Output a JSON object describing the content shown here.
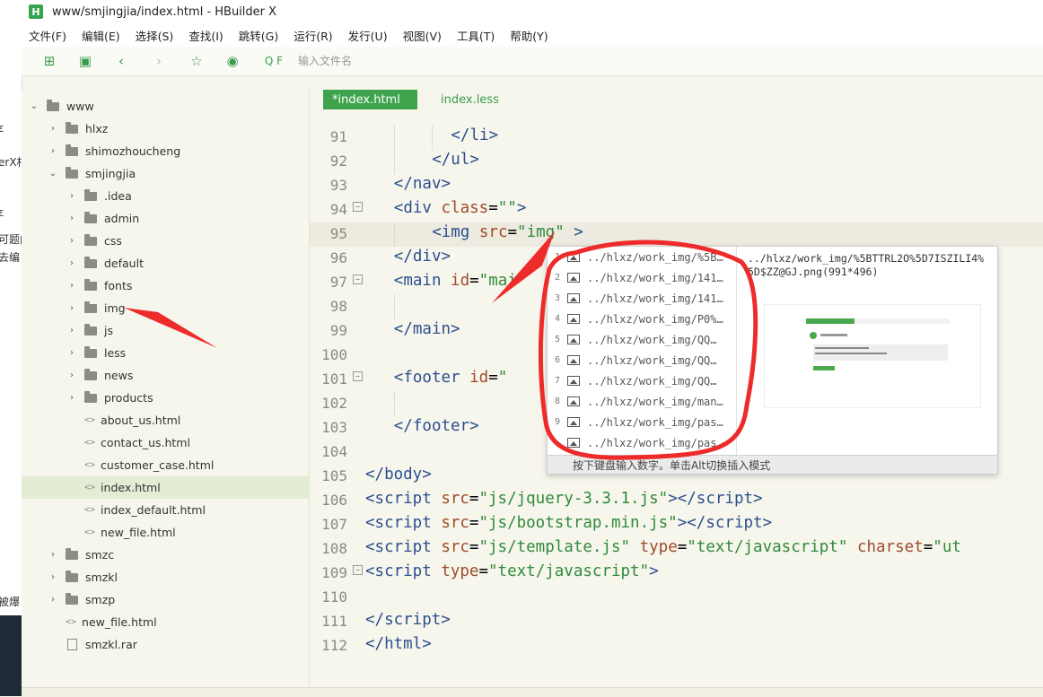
{
  "window": {
    "title": "www/smjingjia/index.html - HBuilder X",
    "logo": "H"
  },
  "background_fragments": [
    "ε",
    "erX相",
    "ε",
    "可题内",
    "去编",
    "被爆"
  ],
  "menu": [
    "文件(F)",
    "编辑(E)",
    "选择(S)",
    "查找(I)",
    "跳转(G)",
    "运行(R)",
    "发行(U)",
    "视图(V)",
    "工具(T)",
    "帮助(Y)"
  ],
  "toolbar": {
    "search_placeholder": "输入文件名",
    "search_prefix": "Q F"
  },
  "file_tree": [
    {
      "label": "www",
      "type": "folder",
      "open": true
    },
    {
      "label": "hlxz",
      "type": "folder"
    },
    {
      "label": "shimozhoucheng",
      "type": "folder"
    },
    {
      "label": "smjingjia",
      "type": "folder",
      "open": true
    },
    {
      "label": ".idea",
      "type": "folder"
    },
    {
      "label": "admin",
      "type": "folder"
    },
    {
      "label": "css",
      "type": "folder"
    },
    {
      "label": "default",
      "type": "folder"
    },
    {
      "label": "fonts",
      "type": "folder"
    },
    {
      "label": "img",
      "type": "folder"
    },
    {
      "label": "js",
      "type": "folder"
    },
    {
      "label": "less",
      "type": "folder"
    },
    {
      "label": "news",
      "type": "folder"
    },
    {
      "label": "products",
      "type": "folder"
    },
    {
      "label": "about_us.html",
      "type": "file"
    },
    {
      "label": "contact_us.html",
      "type": "file"
    },
    {
      "label": "customer_case.html",
      "type": "file"
    },
    {
      "label": "index.html",
      "type": "file",
      "selected": true
    },
    {
      "label": "index_default.html",
      "type": "file"
    },
    {
      "label": "new_file.html",
      "type": "file"
    },
    {
      "label": "smzc",
      "type": "folder"
    },
    {
      "label": "smzkl",
      "type": "folder"
    },
    {
      "label": "smzp",
      "type": "folder"
    },
    {
      "label": "new_file.html",
      "type": "file"
    },
    {
      "label": "smzkl.rar",
      "type": "archive"
    }
  ],
  "tabs": [
    {
      "label": "*index.html",
      "active": true
    },
    {
      "label": "index.less",
      "active": false
    }
  ],
  "code_lines": [
    {
      "n": "91",
      "html": "<span class=\"tag\">&lt;/li&gt;</span>"
    },
    {
      "n": "92",
      "html": "<span class=\"tag\">&lt;/ul&gt;</span>"
    },
    {
      "n": "93",
      "html": "<span class=\"tag\">&lt;/nav&gt;</span>"
    },
    {
      "n": "94",
      "html": "<span class=\"tag\">&lt;div</span> <span class=\"attr\">class</span>=<span class=\"str\">\"\"</span><span class=\"tag\">&gt;</span>"
    },
    {
      "n": "95",
      "html": "<span class=\"tag\">&lt;img</span> <span class=\"attr\">src</span>=<span class=\"str\">\"img\"</span> <span class=\"tag\">&gt;</span>"
    },
    {
      "n": "96",
      "html": "<span class=\"tag\">&lt;/div&gt;</span>"
    },
    {
      "n": "97",
      "html": "<span class=\"tag\">&lt;main</span> <span class=\"attr\">id</span>=<span class=\"str\">\"mai</span>"
    },
    {
      "n": "98",
      "html": ""
    },
    {
      "n": "99",
      "html": "<span class=\"tag\">&lt;/main&gt;</span>"
    },
    {
      "n": "100",
      "html": ""
    },
    {
      "n": "101",
      "html": "<span class=\"tag\">&lt;footer</span> <span class=\"attr\">id</span>=<span class=\"str\">\"</span>"
    },
    {
      "n": "102",
      "html": ""
    },
    {
      "n": "103",
      "html": "<span class=\"tag\">&lt;/footer&gt;</span>"
    },
    {
      "n": "104",
      "html": ""
    },
    {
      "n": "105",
      "html": "<span class=\"tag\">&lt;/body&gt;</span>"
    },
    {
      "n": "106",
      "html": "<span class=\"tag\">&lt;script</span> <span class=\"attr\">src</span>=<span class=\"str\">\"js/jquery-3.3.1.js\"</span><span class=\"tag\">&gt;&lt;/script&gt;</span>"
    },
    {
      "n": "107",
      "html": "<span class=\"tag\">&lt;script</span> <span class=\"attr\">src</span>=<span class=\"str\">\"js/bootstrap.min.js\"</span><span class=\"tag\">&gt;&lt;/script&gt;</span>"
    },
    {
      "n": "108",
      "html": "<span class=\"tag\">&lt;script</span> <span class=\"attr\">src</span>=<span class=\"str\">\"js/template.js\"</span> <span class=\"attr\">type</span>=<span class=\"str\">\"text/javascript\"</span> <span class=\"attr\">charset</span>=<span class=\"str\">\"ut</span>"
    },
    {
      "n": "109",
      "html": "<span class=\"tag\">&lt;script</span> <span class=\"attr\">type</span>=<span class=\"str\">\"text/javascript\"</span><span class=\"tag\">&gt;</span>"
    },
    {
      "n": "110",
      "html": ""
    },
    {
      "n": "111",
      "html": "<span class=\"tag\">&lt;/script&gt;</span>"
    },
    {
      "n": "112",
      "html": "<span class=\"tag\">&lt;/html&gt;</span>"
    }
  ],
  "fold_lines": [
    "94",
    "97",
    "101",
    "109"
  ],
  "current_line": "95",
  "autocomplete": {
    "items": [
      {
        "num": "1",
        "path": "../hlxz/work_img/%5B…"
      },
      {
        "num": "2",
        "path": "../hlxz/work_img/141…"
      },
      {
        "num": "3",
        "path": "../hlxz/work_img/141…"
      },
      {
        "num": "4",
        "path": "../hlxz/work_img/P0%…"
      },
      {
        "num": "5",
        "path": "../hlxz/work_img/QQ…"
      },
      {
        "num": "6",
        "path": "../hlxz/work_img/QQ…"
      },
      {
        "num": "7",
        "path": "../hlxz/work_img/QQ…"
      },
      {
        "num": "8",
        "path": "../hlxz/work_img/man…"
      },
      {
        "num": "9",
        "path": "../hlxz/work_img/pas…"
      },
      {
        "num": "",
        "path": "../hlxz/work_img/pas…"
      }
    ],
    "detail": "../hlxz/work_img/%5BTTRL2O%5D7ISZILI4%5D$ZZ@GJ.png(991*496)",
    "status": "按下键盘输入数字。单击Alt切换插入模式"
  },
  "colors": {
    "accent": "#3fa34d",
    "annotation": "#ee2b2b"
  }
}
